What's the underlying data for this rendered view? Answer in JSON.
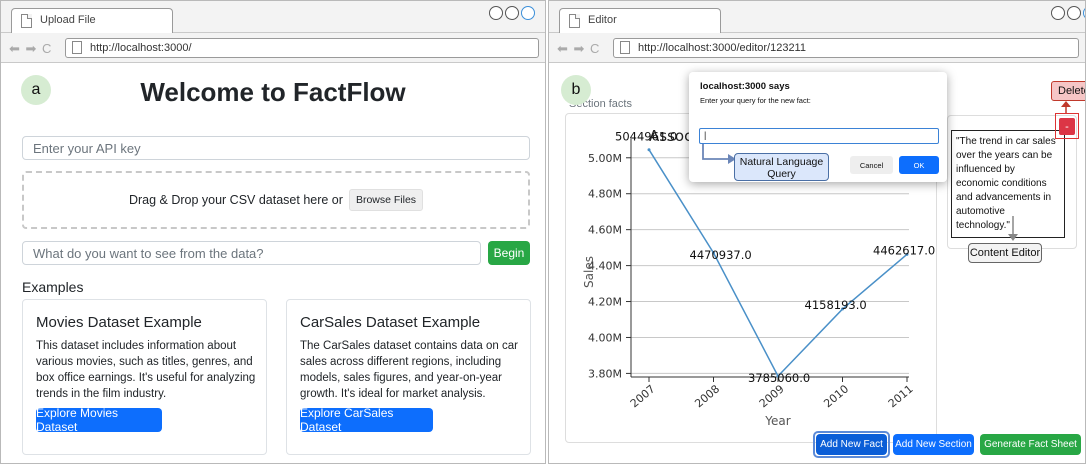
{
  "left": {
    "tab_title": "Upload File",
    "nav_glyphs": "⬅ ➡ C",
    "url": "http://localhost:3000/",
    "panel_label": "a",
    "heading": "Welcome to FactFlow",
    "api_key_placeholder": "Enter your API key",
    "drop_text": "Drag & Drop your CSV dataset here or",
    "browse_label": "Browse Files",
    "query_placeholder": "What do you want to see from the data?",
    "begin_label": "Begin",
    "examples_heading": "Examples",
    "cards": [
      {
        "title": "Movies Dataset Example",
        "body": "This dataset includes information about various movies, such as titles, genres, and box office earnings. It's useful for analyzing trends in the film industry.",
        "button": "Explore Movies Dataset"
      },
      {
        "title": "CarSales Dataset Example",
        "body": "The CarSales dataset contains data on car sales across different regions, including models, sales figures, and year-on-year growth. It's ideal for market analysis.",
        "button": "Explore CarSales Dataset"
      }
    ]
  },
  "right": {
    "tab_title": "Editor",
    "nav_glyphs": "⬅ ➡ C",
    "url": "http://localhost:3000/editor/123211",
    "panel_label": "b",
    "section_label": "Section facts",
    "delete_label": "Delete",
    "minus_label": "-",
    "fact_text": "\"The trend in car sales over the years can be influenced by economic conditions and advancements in automotive technology.\"",
    "content_editor_label": "Content Editor",
    "dialog": {
      "title": "localhost:3000 says",
      "message": "Enter your query for the new fact:",
      "input_value": "|",
      "cancel_label": "Cancel",
      "ok_label": "OK"
    },
    "nlq_label": "Natural Language Query",
    "buttons": {
      "add_fact": "Add New Fact",
      "add_section": "Add New Section",
      "generate": "Generate Fact Sheet"
    }
  },
  "colors": {
    "primary": "#0d6efd",
    "success": "#28a745",
    "danger": "#dc3545",
    "line": "#4a90c8",
    "panel_label_bg": "#d6ecd2"
  },
  "chart_data": {
    "type": "line",
    "title": "Associ",
    "xlabel": "Year",
    "ylabel": "Sales",
    "x": [
      "2007",
      "2008",
      "2009",
      "2010",
      "2011"
    ],
    "series": [
      {
        "values": [
          5044961.0,
          4470937.0,
          3785060.0,
          4158193.0,
          4462617.0
        ]
      }
    ],
    "data_labels": [
      "5044961.0",
      "4470937.0",
      "3785060.0",
      "4158193.0",
      "4462617.0"
    ],
    "yticks": [
      "3.80M",
      "4.00M",
      "4.20M",
      "4.40M",
      "4.60M",
      "4.80M",
      "5.00M"
    ],
    "ytick_values": [
      3800000,
      4000000,
      4200000,
      4400000,
      4600000,
      4800000,
      5000000
    ],
    "ylim": [
      3780000,
      5060000
    ],
    "grid": true
  }
}
